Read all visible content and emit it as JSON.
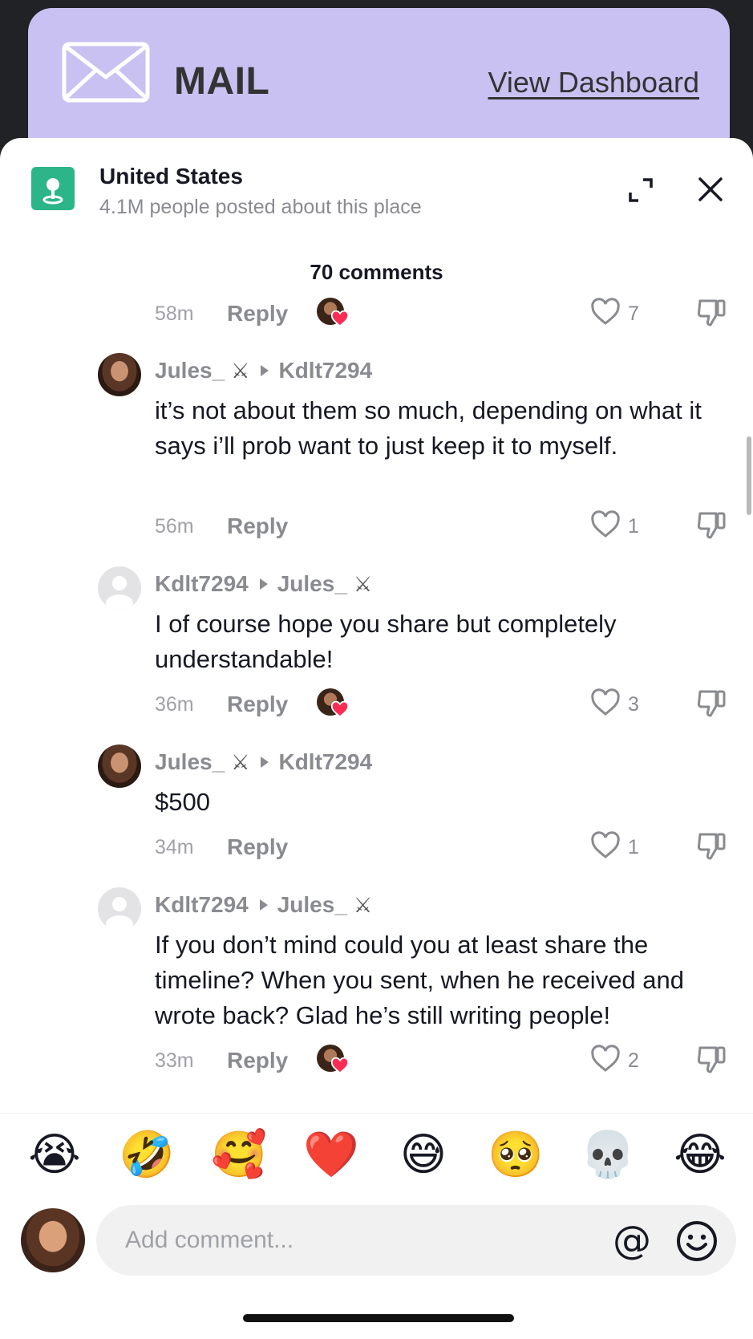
{
  "banner": {
    "label": "MAIL",
    "link": "View Dashboard"
  },
  "place": {
    "title": "United States",
    "subtitle": "4.1M people posted about this place"
  },
  "comments_count": "70 comments",
  "rows": [
    {
      "time": "58m",
      "reply": "Reply",
      "likes": "7",
      "creator_liked": true
    },
    {
      "time": "56m",
      "reply": "Reply",
      "likes": "1",
      "creator_liked": false
    },
    {
      "time": "36m",
      "reply": "Reply",
      "likes": "3",
      "creator_liked": true
    },
    {
      "time": "34m",
      "reply": "Reply",
      "likes": "1",
      "creator_liked": false
    },
    {
      "time": "33m",
      "reply": "Reply",
      "likes": "2",
      "creator_liked": true
    }
  ],
  "comments": [
    {
      "author": "Jules_",
      "author_badge": "⚔",
      "reply_to": "Kdlt7294",
      "reply_badge": "",
      "text": "it’s not about them so much, depending on what it says i’ll prob want to just keep it to myself."
    },
    {
      "author": "Kdlt7294",
      "author_badge": "",
      "reply_to": "Jules_",
      "reply_badge": "⚔",
      "text": "I of course hope you share but completely understandable!"
    },
    {
      "author": "Jules_",
      "author_badge": "⚔",
      "reply_to": "Kdlt7294",
      "reply_badge": "",
      "text": "$500"
    },
    {
      "author": "Kdlt7294",
      "author_badge": "",
      "reply_to": "Jules_",
      "reply_badge": "⚔",
      "text": "If you don’t mind could you at least share the timeline? When you sent, when he received and wrote back? Glad he’s still writing people!"
    }
  ],
  "emojis": [
    "😭",
    "🤣",
    "🥰",
    "❤️",
    "😅",
    "🥺",
    "💀",
    "😂"
  ],
  "composer": {
    "placeholder": "Add comment...",
    "at": "@"
  },
  "colors": {
    "banner": "#c9c1f2",
    "place_icon": "#2bb589",
    "heart": "#fe2c55"
  }
}
